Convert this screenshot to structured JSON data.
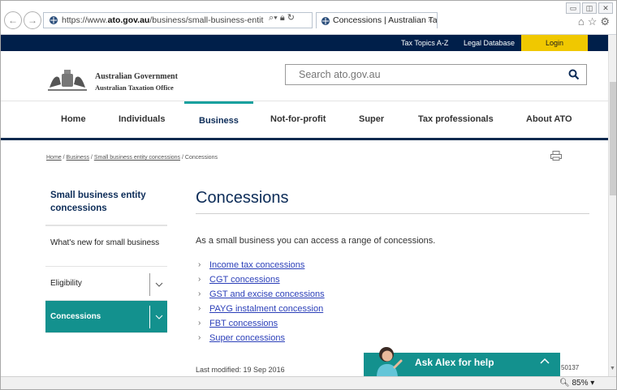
{
  "browser": {
    "url_prefix": "https://www.",
    "url_domain": "ato.gov.au",
    "url_path": "/business/small-business-entit",
    "tab_title": "Concessions | Australian Ta...",
    "tab_close": "×",
    "zoom": "85%"
  },
  "utility_nav": {
    "tax_topics": "Tax Topics A-Z",
    "legal_database": "Legal Database",
    "login": "Login"
  },
  "header": {
    "org_line1": "Australian Government",
    "org_line2": "Australian Taxation Office",
    "search_placeholder": "Search ato.gov.au"
  },
  "main_nav": {
    "home": "Home",
    "individuals": "Individuals",
    "business": "Business",
    "not_for_profit": "Not-for-profit",
    "super": "Super",
    "tax_professionals": "Tax professionals",
    "about": "About ATO"
  },
  "breadcrumb": {
    "home": "Home",
    "business": "Business",
    "sbe": "Small business entity concessions",
    "current": "Concessions",
    "sep": "/"
  },
  "sidebar": {
    "title": "Small business entity concessions",
    "items": [
      {
        "label": "What's new for small business"
      },
      {
        "label": "Eligibility"
      },
      {
        "label": "Concessions"
      }
    ]
  },
  "content": {
    "heading": "Concessions",
    "intro": "As a small business you can access a range of concessions.",
    "links": [
      "Income tax concessions",
      "CGT concessions",
      "GST and excise concessions",
      "PAYG instalment concession",
      "FBT concessions",
      "Super concessions"
    ],
    "last_modified": "Last modified: 19 Sep 2016",
    "page_id_fragment": "50137"
  },
  "chat": {
    "label": "Ask Alex for help"
  },
  "colors": {
    "navy": "#001f4a",
    "teal": "#13918e",
    "login_yellow": "#f0c800",
    "link_blue": "#2b3fb9"
  }
}
